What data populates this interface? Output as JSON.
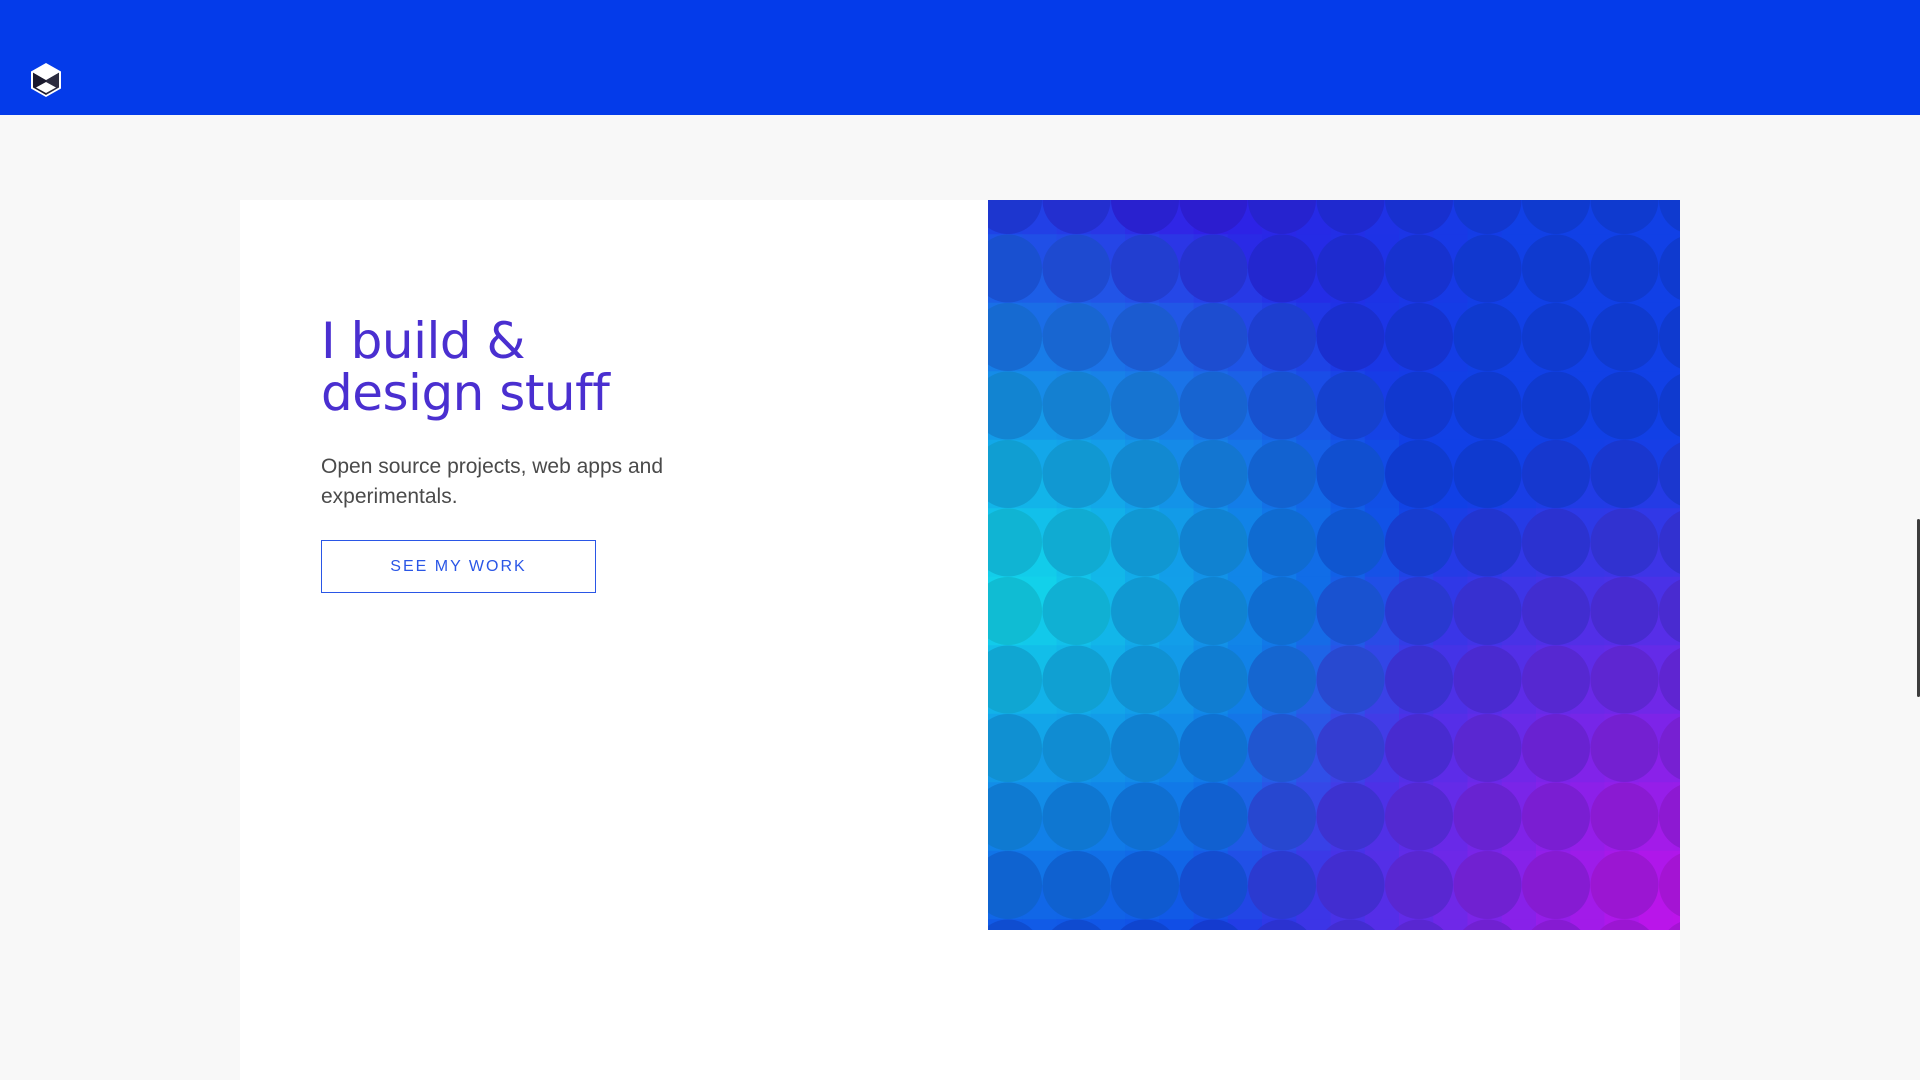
{
  "header": {
    "logo_icon": "hexagon-cube-logo-icon",
    "background_color": "#043bea"
  },
  "hero": {
    "title_line1": "I build &",
    "title_line2": "design stuff",
    "subtitle": "Open source projects, web apps and experimentals.",
    "cta_label": "SEE MY WORK",
    "title_color": "#4a2fd0",
    "accent_color": "#2a56e6"
  },
  "artwork": {
    "description_icon": "circle-grid-gradient-art",
    "colors": {
      "cyan": "#12d2ea",
      "blue": "#1140e6",
      "magenta": "#c412ea"
    }
  }
}
